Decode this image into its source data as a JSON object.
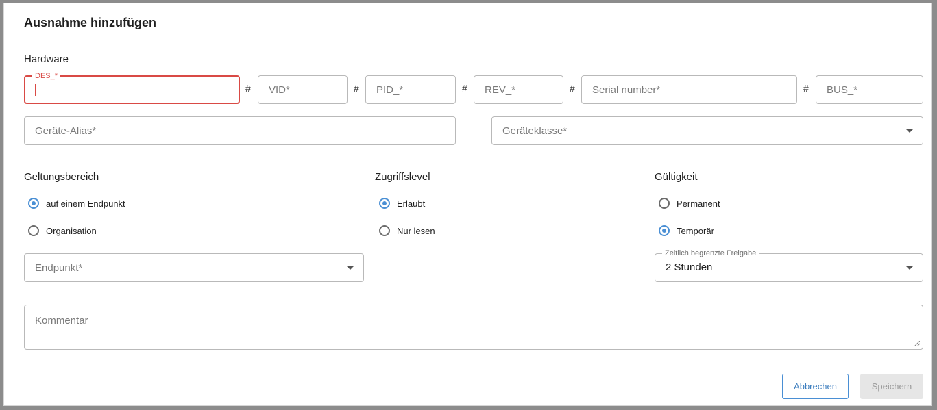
{
  "dialog": {
    "title": "Ausnahme hinzufügen"
  },
  "hardware": {
    "label": "Hardware",
    "des": {
      "float_label": "DES_*",
      "value": ""
    },
    "separator": "#",
    "vid": {
      "placeholder": "VID*"
    },
    "pid": {
      "placeholder": "PID_*"
    },
    "rev": {
      "placeholder": "REV_*"
    },
    "serial": {
      "placeholder": "Serial number*"
    },
    "bus": {
      "placeholder": "BUS_*"
    },
    "alias": {
      "placeholder": "Geräte-Alias*"
    },
    "device_class": {
      "placeholder": "Geräteklasse*"
    }
  },
  "scope": {
    "label": "Geltungsbereich",
    "options": [
      {
        "label": "auf einem Endpunkt",
        "checked": true
      },
      {
        "label": "Organisation",
        "checked": false
      }
    ],
    "endpoint": {
      "placeholder": "Endpunkt*"
    }
  },
  "access": {
    "label": "Zugriffslevel",
    "options": [
      {
        "label": "Erlaubt",
        "checked": true
      },
      {
        "label": "Nur lesen",
        "checked": false
      }
    ]
  },
  "validity": {
    "label": "Gültigkeit",
    "options": [
      {
        "label": "Permanent",
        "checked": false
      },
      {
        "label": "Temporär",
        "checked": true
      }
    ],
    "duration": {
      "float_label": "Zeitlich begrenzte Freigabe",
      "value": "2 Stunden"
    }
  },
  "comment": {
    "placeholder": "Kommentar"
  },
  "buttons": {
    "cancel": "Abbrechen",
    "save": "Speichern"
  },
  "colors": {
    "accent": "#4a8fd4",
    "error": "#d94a45",
    "disabled_bg": "#e6e6e6"
  }
}
